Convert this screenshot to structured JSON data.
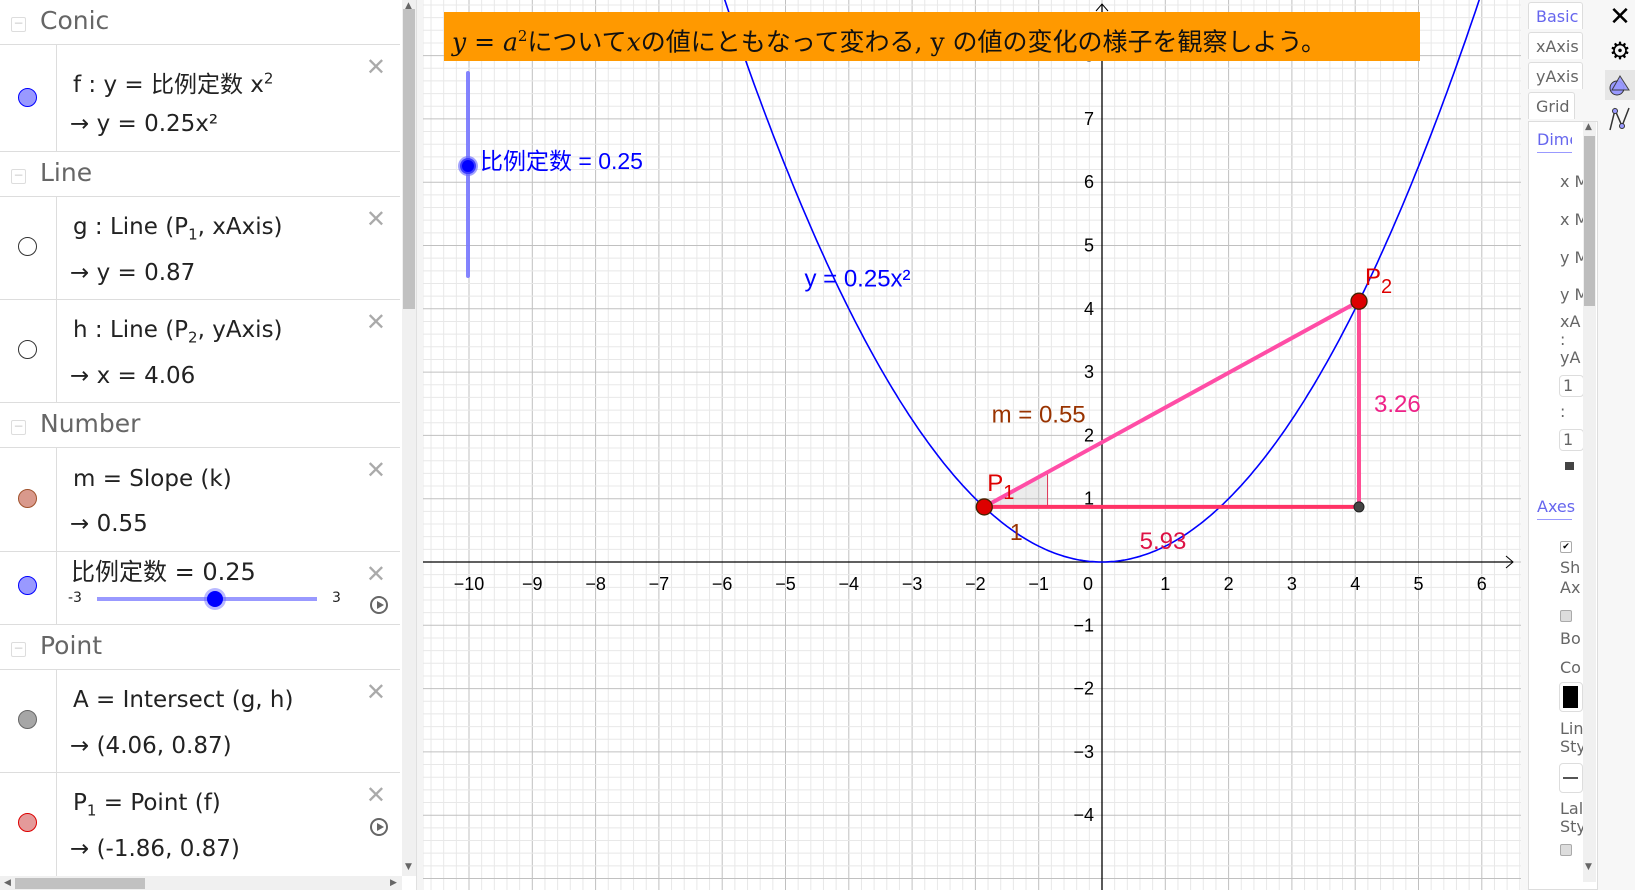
{
  "algebra": {
    "categories": {
      "conic": "Conic",
      "line": "Line",
      "number": "Number",
      "point": "Point"
    },
    "items": [
      {
        "name": "f",
        "definition_prefix": "f : y = ",
        "definition_cjk": "比例定数",
        "definition_suffix": " x",
        "definition_sup": "2",
        "value": "→ y = 0.25x²",
        "color": "#9999ff",
        "border": "#0000ff"
      },
      {
        "name": "g",
        "definition_prefix": "g : Line (P",
        "definition_sub": "1",
        "definition_suffix": ", xAxis)",
        "value": "→ y = 0.87",
        "color": "#ffffff",
        "border": "#333333"
      },
      {
        "name": "h",
        "definition_prefix": "h : Line (P",
        "definition_sub": "2",
        "definition_suffix": ", yAxis)",
        "value": "→ x = 4.06",
        "color": "#ffffff",
        "border": "#333333"
      },
      {
        "name": "m",
        "definition_prefix": "m = Slope (k)",
        "value": "→ 0.55",
        "color": "#d9998c",
        "border": "#a0522d"
      },
      {
        "name": "比例定数",
        "definition_prefix": "比例定数 = 0.25",
        "slider_min": "-3",
        "slider_max": "3",
        "slider_value": 0.25,
        "color": "#9999ff",
        "border": "#0000ff"
      },
      {
        "name": "A",
        "definition_prefix": "A = Intersect (g, h)",
        "value": "→ (4.06, 0.87)",
        "color": "#a6a6a6",
        "border": "#666666"
      },
      {
        "name": "P1",
        "definition_prefix": "P",
        "definition_sub": "1",
        "definition_suffix": " = Point (f)",
        "value": "→ (-1.86, 0.87)",
        "color": "#e49a9a",
        "border": "#dd0000"
      }
    ]
  },
  "graphics": {
    "banner": {
      "math_prefix": "y = a",
      "math_sup": "2",
      "text_1": "について",
      "math_x": "x",
      "text_2": "の値にともなって変わる, y の値の変化の様子を観察しよう。",
      "color": "#ff9900"
    },
    "slider_label": "比例定数 = 0.25",
    "slider_value": 0.25,
    "slider_min": -3,
    "slider_max": 3,
    "curve_label": "y = 0.25x²",
    "slope_label": "m = 0.55",
    "slope_unit_label": "1",
    "run_label": "5.93",
    "rise_label": "3.26",
    "point_p1_label": "P",
    "point_p1_sub": "1",
    "point_p2_label": "P",
    "point_p2_sub": "2",
    "a_coefficient": 0.25,
    "p1": [
      -1.86,
      0.87
    ],
    "p2": [
      4.06,
      4.12
    ],
    "a_point": [
      4.06,
      0.87
    ],
    "x_ticks": [
      "−10",
      "−9",
      "−8",
      "−7",
      "−6",
      "−5",
      "−4",
      "−3",
      "−2",
      "−1",
      "0",
      "1",
      "2",
      "3",
      "4",
      "5",
      "6"
    ],
    "y_ticks": [
      "−4",
      "−3",
      "−2",
      "−1",
      "1",
      "2",
      "3",
      "4",
      "5",
      "6",
      "7",
      "8"
    ],
    "x_range": [
      -10.5,
      6.6
    ],
    "y_range": [
      -5.1,
      8.9
    ],
    "colors": {
      "curve": "#0000ff",
      "segment": "#ff3399",
      "point": "#dd0000",
      "slope": "#993300",
      "slider": "#0000ff"
    }
  },
  "settings": {
    "tabs": [
      "Basic",
      "xAxis",
      "yAxis",
      "Grid"
    ],
    "section_dimensions": "Dimer",
    "dim_labels": [
      "x M",
      "x M",
      "y M",
      "y M"
    ],
    "ratio_labels": [
      "xA",
      ":",
      "yA"
    ],
    "ratio_values": [
      "1",
      "1"
    ],
    "ratio_colon": ":",
    "section_axes": "Axes",
    "axes_labels": [
      "Sh",
      "Ax",
      "Bo",
      "Co",
      "Lin",
      "Sty",
      "Lal",
      "Sty"
    ]
  }
}
